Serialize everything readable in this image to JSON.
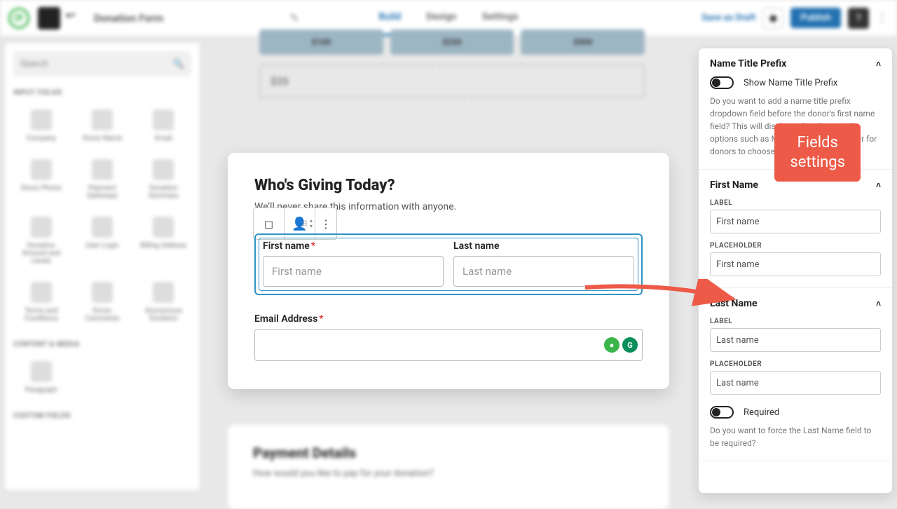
{
  "topbar": {
    "form_name": "Donation Form",
    "tabs": {
      "build": "Build",
      "design": "Design",
      "settings": "Settings"
    },
    "save_draft": "Save as Draft",
    "publish": "Publish"
  },
  "sidebar": {
    "search_placeholder": "Search",
    "section_input": "INPUT FIELDS",
    "section_content": "CONTENT & MEDIA",
    "section_custom": "CUSTOM FIELDS",
    "items": {
      "company": "Company",
      "donor_name": "Donor Name",
      "email": "Email",
      "donor_phone": "Donor Phone",
      "payment_gateways": "Payment Gateways",
      "donation_summary": "Donation Summary",
      "donation_amount": "Donation Amount and Levels",
      "user_login": "User Login",
      "billing_address": "Billing Address",
      "terms": "Terms and Conditions",
      "donor_comments": "Donor Comments",
      "anonymous": "Anonymous Donation",
      "paragraph": "Paragraph"
    }
  },
  "canvas": {
    "amounts": [
      "$100",
      "$250",
      "$500"
    ],
    "custom_amount": "$25"
  },
  "form": {
    "title": "Who's Giving Today?",
    "subtitle": "We'll never share this information with anyone.",
    "first_name_label": "First name",
    "first_name_placeholder": "First name",
    "last_name_label": "Last name",
    "last_name_placeholder": "Last name",
    "email_label": "Email Address"
  },
  "payment": {
    "title": "Payment Details",
    "subtitle": "How would you like to pay for your donation?"
  },
  "settings": {
    "prefix": {
      "title": "Name Title Prefix",
      "toggle_label": "Show Name Title Prefix",
      "desc": "Do you want to add a name title prefix dropdown field before the donor's first name field? This will display a dropdown with options such as Mrs, Miss, Ms, Sir, and Dr for donors to choose from."
    },
    "first_name": {
      "title": "First Name",
      "label_caption": "LABEL",
      "label_value": "First name",
      "placeholder_caption": "PLACEHOLDER",
      "placeholder_value": "First name"
    },
    "last_name": {
      "title": "Last Name",
      "label_caption": "LABEL",
      "label_value": "Last name",
      "placeholder_caption": "PLACEHOLDER",
      "placeholder_value": "Last name",
      "required_label": "Required",
      "required_desc": "Do you want to force the Last Name field to be required?"
    }
  },
  "callout": {
    "line1": "Fields",
    "line2": "settings"
  }
}
